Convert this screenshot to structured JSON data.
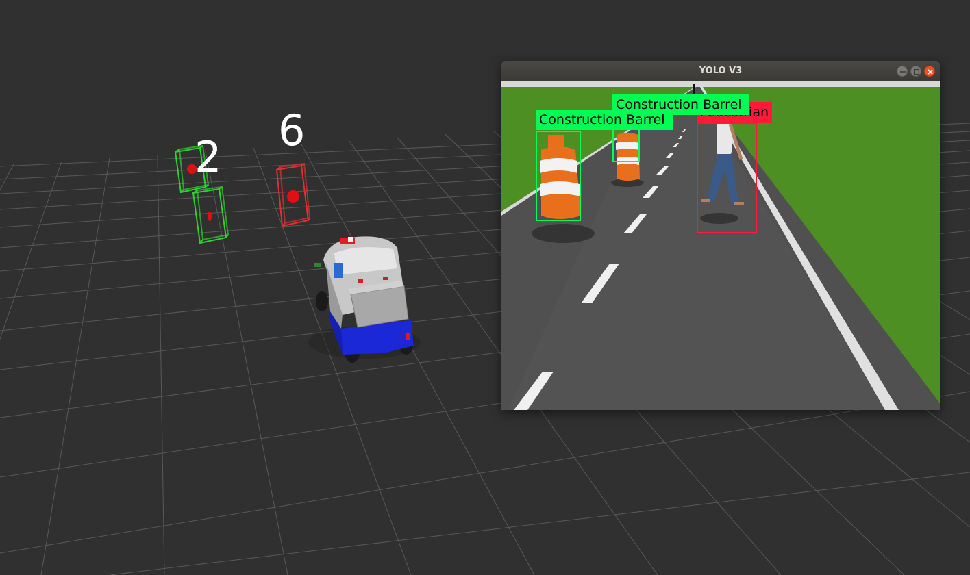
{
  "scene": {
    "track_labels": [
      "2",
      "6"
    ]
  },
  "window": {
    "title": "YOLO V3",
    "controls": [
      "minimize",
      "maximize",
      "close"
    ]
  },
  "detections": [
    {
      "label": "Construction Barrel",
      "color": "#00ff55"
    },
    {
      "label": "Construction Barrel",
      "color": "#00ff55"
    },
    {
      "label": "Pedestrian",
      "color": "#ff1a3c"
    }
  ],
  "colors": {
    "background": "#303030",
    "grid": "#6a6a6a",
    "track_green": "#28c828",
    "track_red": "#e03030",
    "close_button": "#e95420",
    "grass": "#4a8a20",
    "road": "#505050"
  }
}
